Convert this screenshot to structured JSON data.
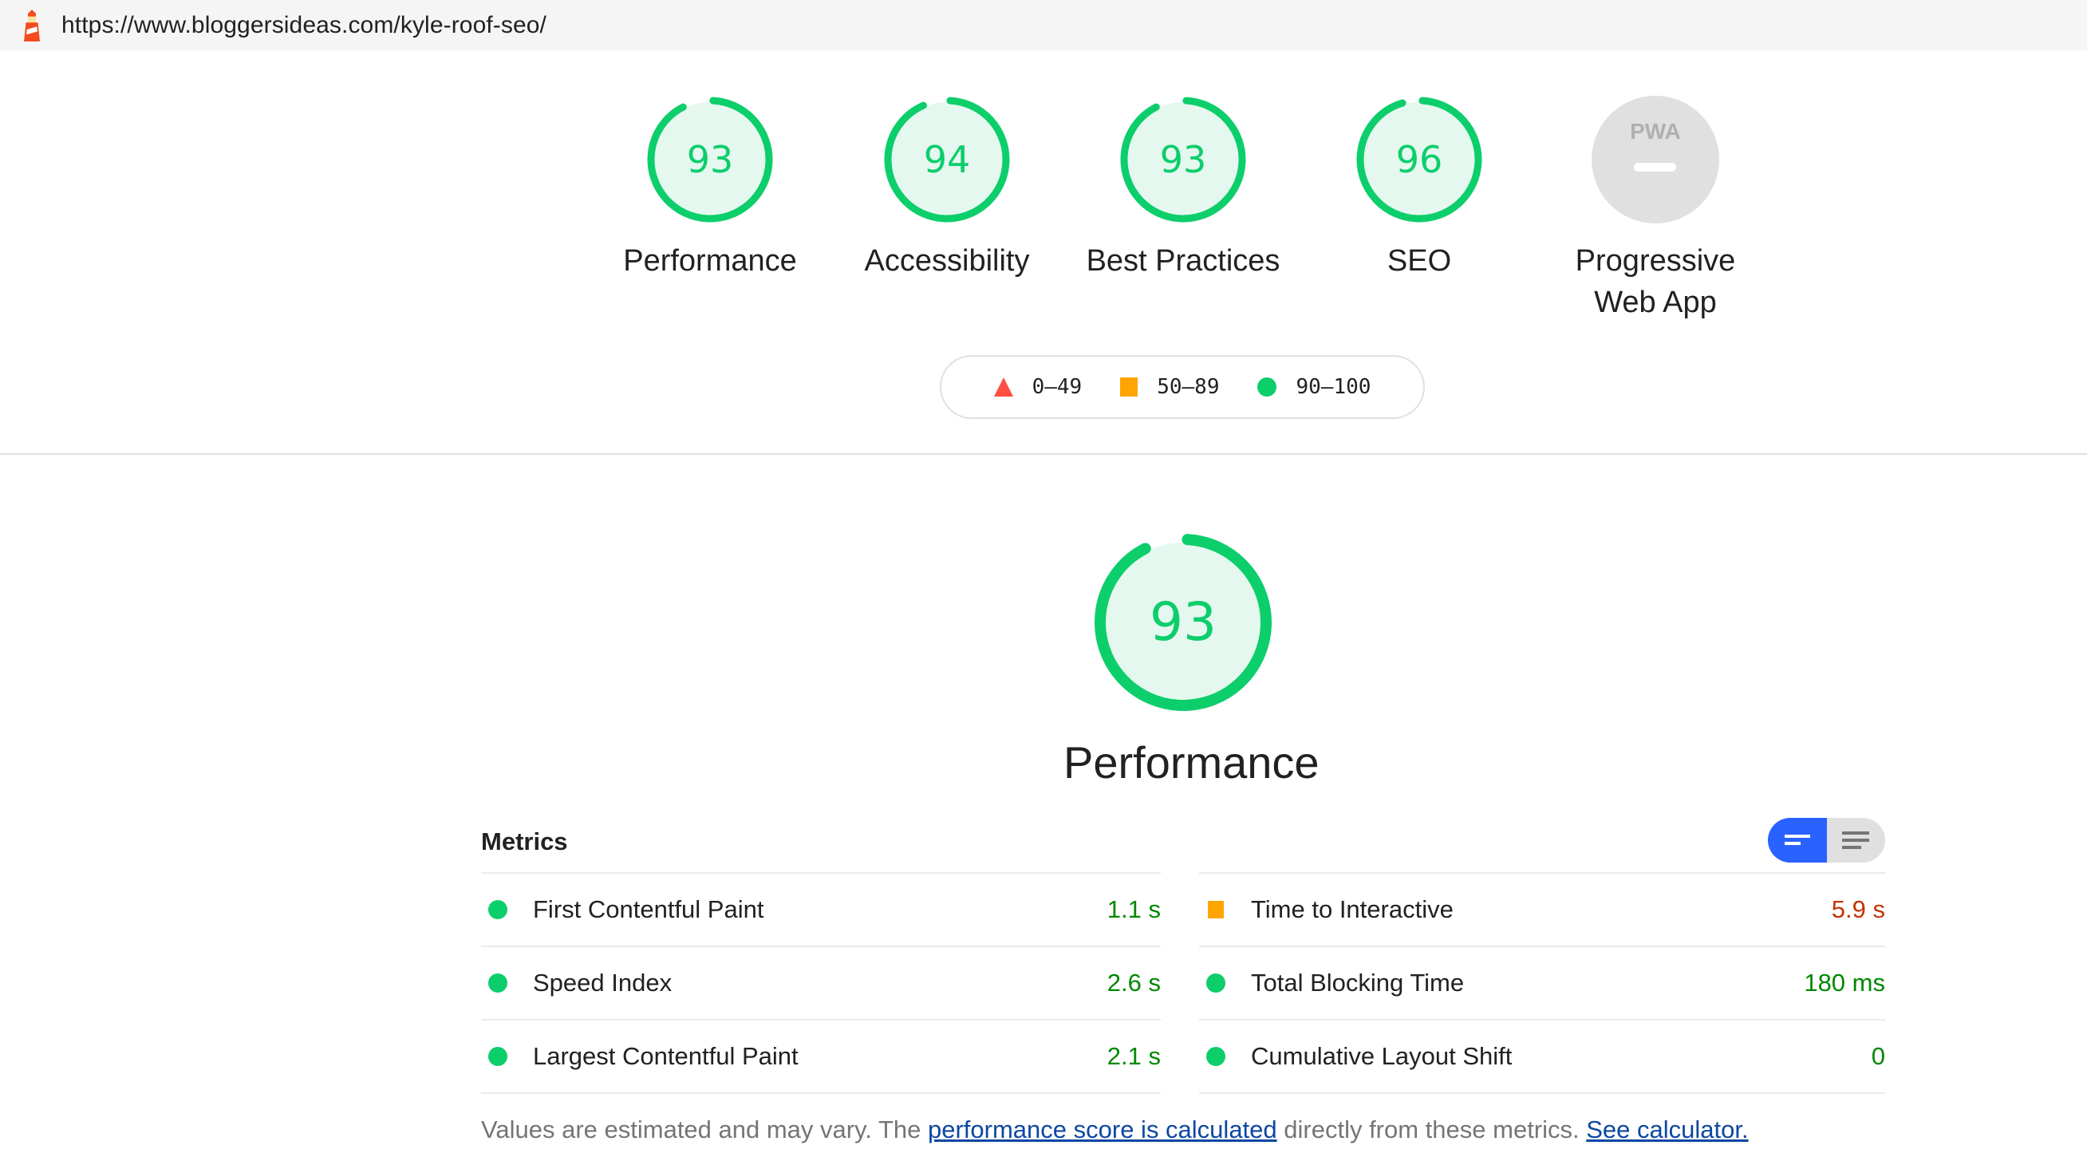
{
  "url_bar": {
    "icon": "lighthouse-icon",
    "url": "https://www.bloggersideas.com/kyle-roof-seo/"
  },
  "colors": {
    "pass": "#0cce6b",
    "pass_text": "#008800",
    "average": "#ffa400",
    "average_text": "#c33300",
    "fail": "#ff4e42",
    "gauge_fill": "#e5f8ef",
    "na": "#e0e0e0",
    "toggle_active": "#2962ff",
    "link": "#0d47a1"
  },
  "categories": [
    {
      "id": "performance",
      "label": "Performance",
      "score": 93
    },
    {
      "id": "accessibility",
      "label": "Accessibility",
      "score": 94
    },
    {
      "id": "best-practices",
      "label": "Best Practices",
      "score": 93
    },
    {
      "id": "seo",
      "label": "SEO",
      "score": 96
    },
    {
      "id": "pwa",
      "label_line1": "Progressive",
      "label_line2": "Web App",
      "badge_text": "PWA",
      "score": null
    }
  ],
  "legend": [
    {
      "shape": "triangle",
      "range": "0–49"
    },
    {
      "shape": "square",
      "range": "50–89"
    },
    {
      "shape": "circle",
      "range": "90–100"
    }
  ],
  "performance_section": {
    "score": 93,
    "title": "Performance",
    "metrics_title": "Metrics",
    "view_toggle": {
      "options": [
        "summary-view",
        "detailed-view"
      ],
      "selected": "summary-view"
    },
    "metrics_left": [
      {
        "name": "First Contentful Paint",
        "value": "1.1 s",
        "rating": "pass"
      },
      {
        "name": "Speed Index",
        "value": "2.6 s",
        "rating": "pass"
      },
      {
        "name": "Largest Contentful Paint",
        "value": "2.1 s",
        "rating": "pass"
      }
    ],
    "metrics_right": [
      {
        "name": "Time to Interactive",
        "value": "5.9 s",
        "rating": "average"
      },
      {
        "name": "Total Blocking Time",
        "value": "180 ms",
        "rating": "pass"
      },
      {
        "name": "Cumulative Layout Shift",
        "value": "0",
        "rating": "pass"
      }
    ],
    "footer": {
      "text1": "Values are estimated and may vary. The ",
      "link1": "performance score is calculated",
      "text2": " directly from these metrics. ",
      "link2": "See calculator."
    }
  }
}
